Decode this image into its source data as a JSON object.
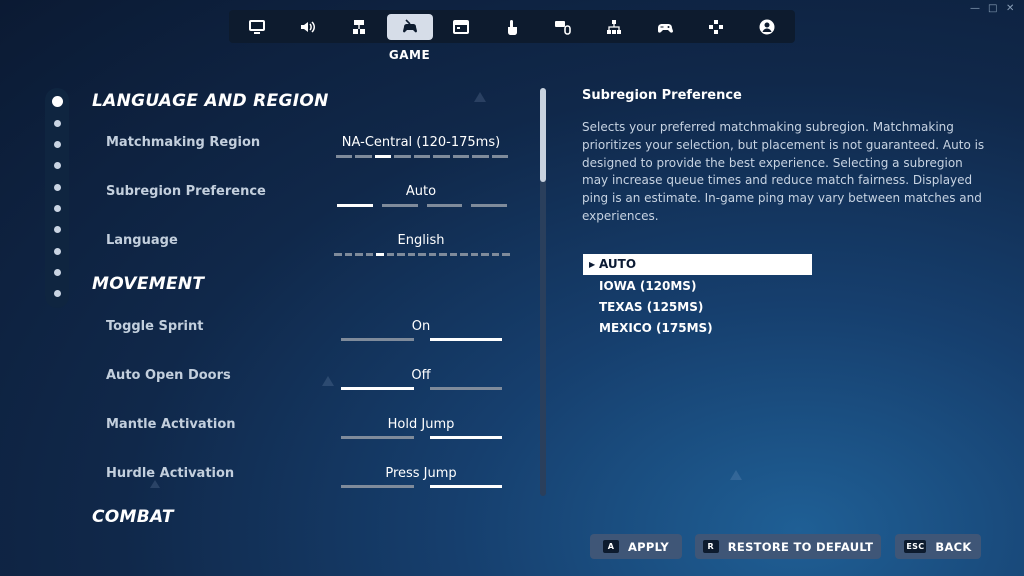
{
  "colors": {
    "accent": "#ffffff",
    "panel": "#0d1b2e",
    "button": "#3f5677",
    "label": "#c3cfdd"
  },
  "tabs": [
    {
      "icon": "monitor-icon"
    },
    {
      "icon": "speaker-icon"
    },
    {
      "icon": "tree-icon"
    },
    {
      "icon": "gamepad-pointer-icon",
      "active": true
    },
    {
      "icon": "window-icon"
    },
    {
      "icon": "touch-icon"
    },
    {
      "icon": "keyboard-mouse-icon"
    },
    {
      "icon": "network-icon"
    },
    {
      "icon": "controller-icon"
    },
    {
      "icon": "dpad-icon"
    },
    {
      "icon": "account-icon"
    }
  ],
  "active_tab_label": "GAME",
  "sections": {
    "language_region": "LANGUAGE AND REGION",
    "movement": "MOVEMENT",
    "combat": "COMBAT"
  },
  "settings": {
    "matchmaking_region": {
      "label": "Matchmaking Region",
      "value": "NA-Central (120-175ms)",
      "segments": 9,
      "selected": 2
    },
    "subregion_preference": {
      "label": "Subregion Preference",
      "value": "Auto",
      "segments": 4,
      "selected": 0
    },
    "language": {
      "label": "Language",
      "value": "English",
      "segments": 17,
      "selected": 4
    },
    "toggle_sprint": {
      "label": "Toggle Sprint",
      "value": "On",
      "segments": 2,
      "selected": 1
    },
    "auto_open_doors": {
      "label": "Auto Open Doors",
      "value": "Off",
      "segments": 2,
      "selected": 0
    },
    "mantle_activation": {
      "label": "Mantle Activation",
      "value": "Hold Jump",
      "segments": 2,
      "selected": 1
    },
    "hurdle_activation": {
      "label": "Hurdle Activation",
      "value": "Press Jump",
      "segments": 2,
      "selected": 1
    }
  },
  "detail": {
    "title": "Subregion Preference",
    "body": "Selects your preferred matchmaking subregion. Matchmaking prioritizes your selection, but placement is not guaranteed. Auto is designed to provide the best experience. Selecting a subregion may increase queue times and reduce match fairness. Displayed ping is an estimate. In-game ping may vary between matches and experiences.",
    "options": [
      "AUTO",
      "IOWA (120MS)",
      "TEXAS (125MS)",
      "MEXICO (175MS)"
    ],
    "selected_option": 0
  },
  "buttons": {
    "apply": {
      "key": "A",
      "label": "APPLY"
    },
    "restore": {
      "key": "R",
      "label": "RESTORE TO DEFAULT"
    },
    "back": {
      "key": "ESC",
      "label": "BACK"
    }
  }
}
